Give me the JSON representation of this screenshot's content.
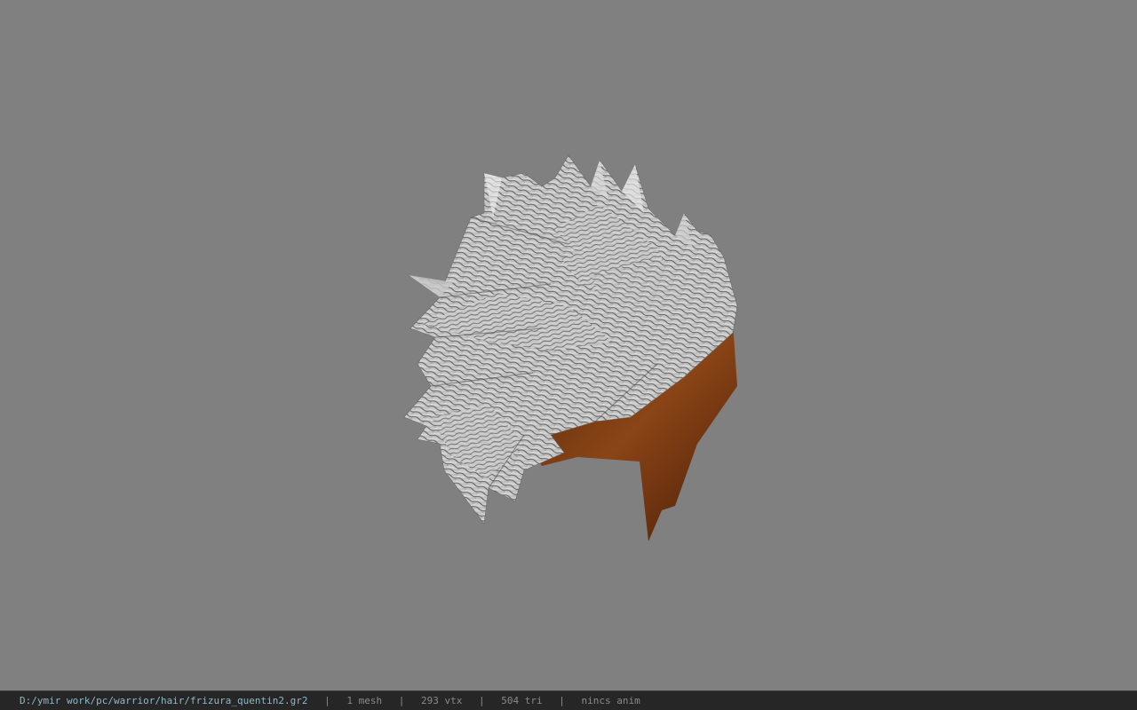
{
  "statusbar": {
    "path": "D:/ymir work/pc/warrior/hair/frizura_quentin2.gr2",
    "separator": "|",
    "meshes": "1 mesh",
    "vertices": "293 vtx",
    "triangles": "504 tri",
    "animation": "nincs anim"
  },
  "colors": {
    "background": "#808080",
    "statusbar": "#262626",
    "path_text": "#8fb8c8",
    "info_text": "#8a8a8a",
    "hair_base": "#7a3a12"
  }
}
